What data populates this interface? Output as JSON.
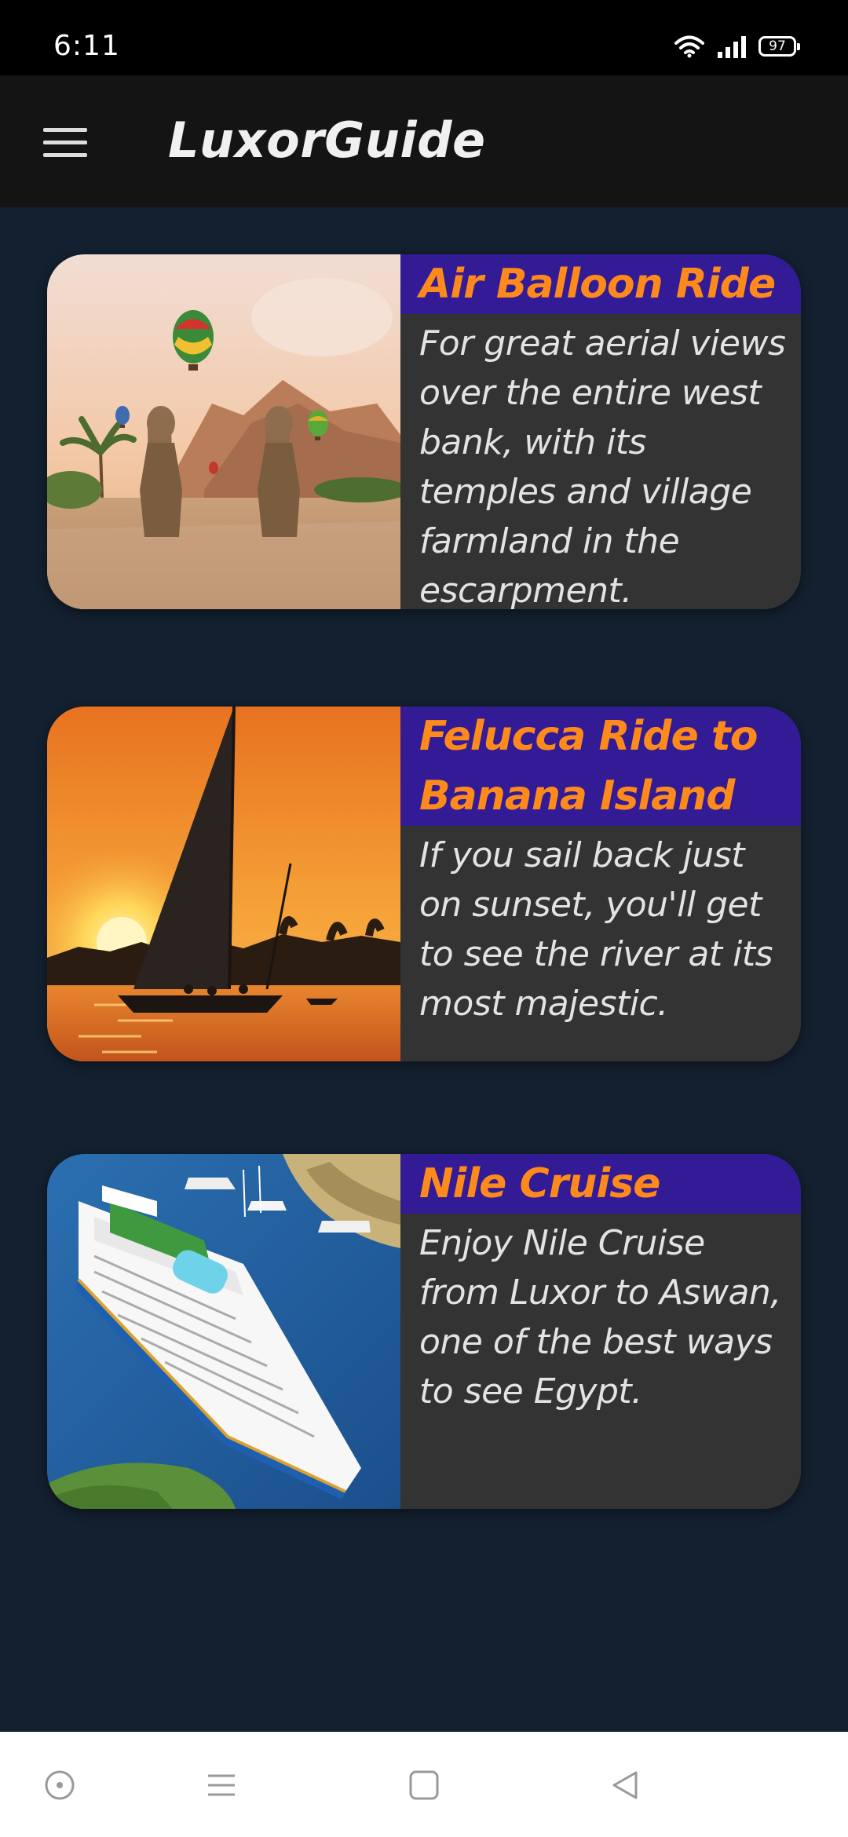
{
  "status_bar": {
    "time": "6:11",
    "battery": "97",
    "icons": [
      "wifi-icon",
      "signal-icon",
      "battery-icon"
    ]
  },
  "app_bar": {
    "title": "LuxorGuide",
    "menu_icon": "hamburger-menu-icon"
  },
  "colors": {
    "background": "#13202f",
    "app_bar": "#141414",
    "card_body": "#333333",
    "card_title_bg": "#331b96",
    "card_title_text": "#ff8a1c",
    "card_desc_text": "#e3e3e3"
  },
  "cards": [
    {
      "title": "Air Balloon Ride",
      "description": "For great aerial views over the entire west bank, with its temples and village farmland in the escarpment.",
      "image": "hot-air-balloons-colossi-image"
    },
    {
      "title": "Felucca Ride to Banana Island",
      "description": "If you sail back just on sunset, you'll get to see the river at its most majestic.",
      "image": "felucca-sunset-image"
    },
    {
      "title": "Nile Cruise",
      "description": "Enjoy Nile Cruise from Luxor to Aswan, one of the best ways to see Egypt.",
      "image": "nile-cruise-ship-image"
    }
  ],
  "nav_bar": {
    "buttons": [
      "assistant-icon",
      "recents-icon",
      "home-icon",
      "back-icon"
    ]
  }
}
